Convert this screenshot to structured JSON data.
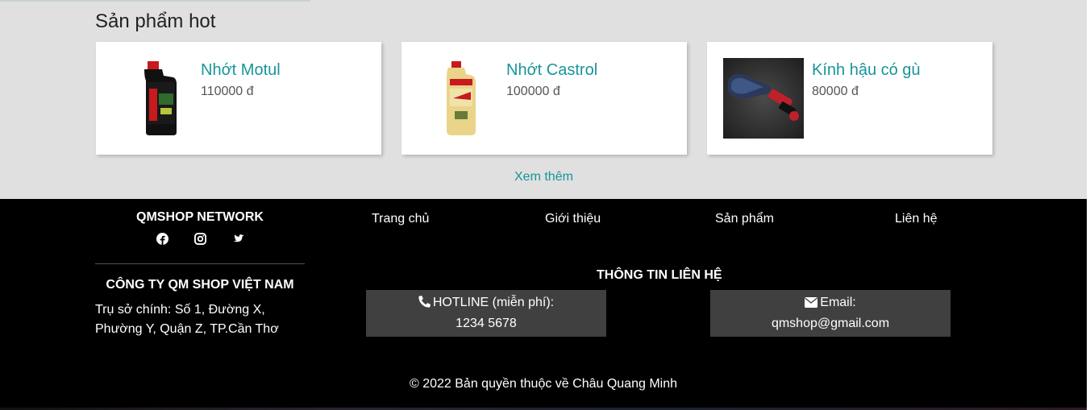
{
  "hot": {
    "title": "Sản phẩm hot",
    "products": [
      {
        "name": "Nhớt Motul",
        "price": "110000 đ",
        "image": "motul-oil-bottle"
      },
      {
        "name": "Nhớt Castrol",
        "price": "100000 đ",
        "image": "castrol-oil-bottle"
      },
      {
        "name": "Kính hậu có gù",
        "price": "80000 đ",
        "image": "rear-mirror"
      }
    ],
    "see_more": "Xem thêm"
  },
  "footer": {
    "brand": "QMSHOP NETWORK",
    "social": [
      "facebook-icon",
      "instagram-icon",
      "twitter-icon"
    ],
    "company": "CÔNG TY QM SHOP VIỆT NAM",
    "address": "Trụ sở chính: Số 1, Đường X, Phường Y, Quận Z, TP.Cần Thơ",
    "nav": [
      "Trang chủ",
      "Giới thiệu",
      "Sản phẩm",
      "Liên hệ"
    ],
    "contact_title": "THÔNG TIN LIÊN HỆ",
    "hotline_label": "HOTLINE (miễn phí):",
    "hotline_value": "1234 5678",
    "email_label": "Email:",
    "email_value": "qmshop@gmail.com",
    "copyright": "© 2022 Bản quyền thuộc về Châu Quang Minh"
  },
  "colors": {
    "accent": "#17959a",
    "section_bg": "#e0e0e0",
    "footer_bg": "#000000",
    "box_bg": "#404040"
  }
}
